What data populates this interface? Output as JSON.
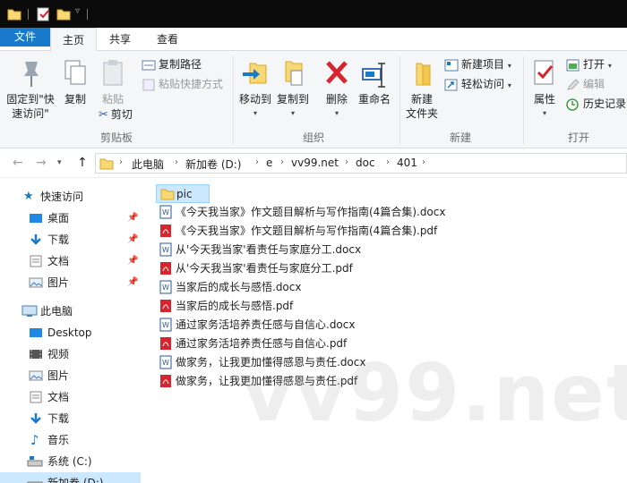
{
  "ribbon_tabs": [
    "文件",
    "主页",
    "共享",
    "查看"
  ],
  "clipboard": {
    "pin_label_line1": "固定到\"快",
    "pin_label_line2": "速访问\"",
    "copy": "复制",
    "paste": "粘贴",
    "copy_path": "复制路径",
    "paste_shortcut": "粘贴快捷方式",
    "cut": "剪切",
    "group": "剪贴板"
  },
  "organize": {
    "move_to": "移动到",
    "copy_to": "复制到",
    "delete": "删除",
    "rename": "重命名",
    "group": "组织"
  },
  "new_group": {
    "new_folder_line1": "新建",
    "new_folder_line2": "文件夹",
    "new_item": "新建项目",
    "easy_access": "轻松访问",
    "group": "新建"
  },
  "open_group": {
    "properties": "属性",
    "open": "打开",
    "edit": "编辑",
    "history": "历史记录",
    "group": "打开"
  },
  "breadcrumb": [
    "此电脑",
    "新加卷 (D:)",
    "e",
    "vv99.net",
    "doc",
    "401"
  ],
  "nav": {
    "quick_access": "快速访问",
    "this_pc": "此电脑",
    "quick_items": [
      "桌面",
      "下载",
      "文档",
      "图片"
    ],
    "pc_items": [
      "Desktop",
      "视频",
      "图片",
      "文档",
      "下载",
      "音乐",
      "系统 (C:)",
      "新加卷 (D:)"
    ]
  },
  "files": [
    {
      "name": "pic",
      "type": "folder"
    },
    {
      "name": "《今天我当家》作文题目解析与写作指南(4篇合集).docx",
      "type": "docx"
    },
    {
      "name": "《今天我当家》作文题目解析与写作指南(4篇合集).pdf",
      "type": "pdf"
    },
    {
      "name": "从'今天我当家'看责任与家庭分工.docx",
      "type": "docx"
    },
    {
      "name": "从'今天我当家'看责任与家庭分工.pdf",
      "type": "pdf"
    },
    {
      "name": "当家后的成长与感悟.docx",
      "type": "docx"
    },
    {
      "name": "当家后的成长与感悟.pdf",
      "type": "pdf"
    },
    {
      "name": "通过家务活培养责任感与自信心.docx",
      "type": "docx"
    },
    {
      "name": "通过家务活培养责任感与自信心.pdf",
      "type": "pdf"
    },
    {
      "name": "做家务，让我更加懂得感恩与责任.docx",
      "type": "docx"
    },
    {
      "name": "做家务，让我更加懂得感恩与责任.pdf",
      "type": "pdf"
    }
  ],
  "watermark": "vv99.net",
  "colors": {
    "accent": "#1979ca",
    "selection": "#cce8ff",
    "folder": "#f8d775",
    "pdf": "#d7252f",
    "word": "#2b5797"
  }
}
